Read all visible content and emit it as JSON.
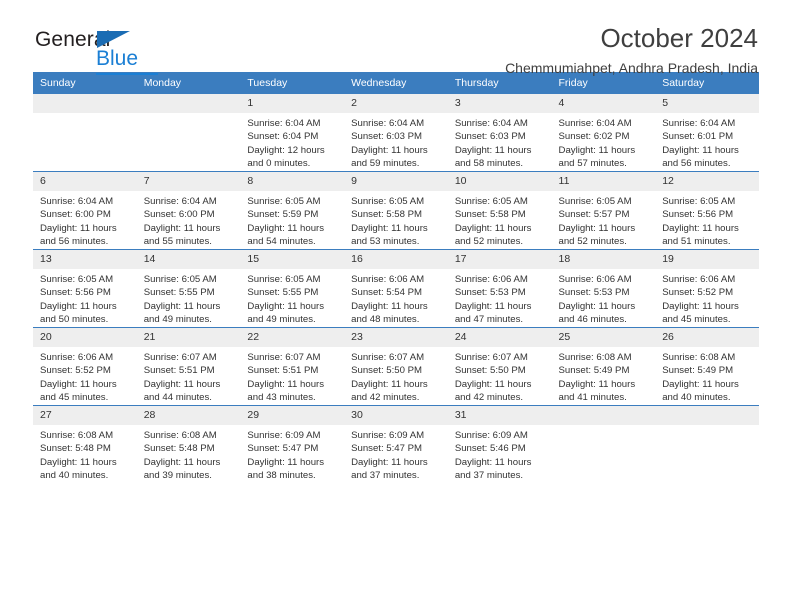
{
  "brand": {
    "name_part1": "General",
    "name_part2": "Blue",
    "logo_icon": "triangle-flag-icon",
    "accent_color": "#1b7fd4",
    "header_color": "#3b7dbf"
  },
  "header": {
    "title": "October 2024",
    "subtitle": "Chemmumiahpet, Andhra Pradesh, India"
  },
  "weekday_headers": [
    "Sunday",
    "Monday",
    "Tuesday",
    "Wednesday",
    "Thursday",
    "Friday",
    "Saturday"
  ],
  "weeks": [
    [
      {
        "day": "",
        "lines": []
      },
      {
        "day": "",
        "lines": []
      },
      {
        "day": "1",
        "lines": [
          "Sunrise: 6:04 AM",
          "Sunset: 6:04 PM",
          "Daylight: 12 hours",
          "and 0 minutes."
        ]
      },
      {
        "day": "2",
        "lines": [
          "Sunrise: 6:04 AM",
          "Sunset: 6:03 PM",
          "Daylight: 11 hours",
          "and 59 minutes."
        ]
      },
      {
        "day": "3",
        "lines": [
          "Sunrise: 6:04 AM",
          "Sunset: 6:03 PM",
          "Daylight: 11 hours",
          "and 58 minutes."
        ]
      },
      {
        "day": "4",
        "lines": [
          "Sunrise: 6:04 AM",
          "Sunset: 6:02 PM",
          "Daylight: 11 hours",
          "and 57 minutes."
        ]
      },
      {
        "day": "5",
        "lines": [
          "Sunrise: 6:04 AM",
          "Sunset: 6:01 PM",
          "Daylight: 11 hours",
          "and 56 minutes."
        ]
      }
    ],
    [
      {
        "day": "6",
        "lines": [
          "Sunrise: 6:04 AM",
          "Sunset: 6:00 PM",
          "Daylight: 11 hours",
          "and 56 minutes."
        ]
      },
      {
        "day": "7",
        "lines": [
          "Sunrise: 6:04 AM",
          "Sunset: 6:00 PM",
          "Daylight: 11 hours",
          "and 55 minutes."
        ]
      },
      {
        "day": "8",
        "lines": [
          "Sunrise: 6:05 AM",
          "Sunset: 5:59 PM",
          "Daylight: 11 hours",
          "and 54 minutes."
        ]
      },
      {
        "day": "9",
        "lines": [
          "Sunrise: 6:05 AM",
          "Sunset: 5:58 PM",
          "Daylight: 11 hours",
          "and 53 minutes."
        ]
      },
      {
        "day": "10",
        "lines": [
          "Sunrise: 6:05 AM",
          "Sunset: 5:58 PM",
          "Daylight: 11 hours",
          "and 52 minutes."
        ]
      },
      {
        "day": "11",
        "lines": [
          "Sunrise: 6:05 AM",
          "Sunset: 5:57 PM",
          "Daylight: 11 hours",
          "and 52 minutes."
        ]
      },
      {
        "day": "12",
        "lines": [
          "Sunrise: 6:05 AM",
          "Sunset: 5:56 PM",
          "Daylight: 11 hours",
          "and 51 minutes."
        ]
      }
    ],
    [
      {
        "day": "13",
        "lines": [
          "Sunrise: 6:05 AM",
          "Sunset: 5:56 PM",
          "Daylight: 11 hours",
          "and 50 minutes."
        ]
      },
      {
        "day": "14",
        "lines": [
          "Sunrise: 6:05 AM",
          "Sunset: 5:55 PM",
          "Daylight: 11 hours",
          "and 49 minutes."
        ]
      },
      {
        "day": "15",
        "lines": [
          "Sunrise: 6:05 AM",
          "Sunset: 5:55 PM",
          "Daylight: 11 hours",
          "and 49 minutes."
        ]
      },
      {
        "day": "16",
        "lines": [
          "Sunrise: 6:06 AM",
          "Sunset: 5:54 PM",
          "Daylight: 11 hours",
          "and 48 minutes."
        ]
      },
      {
        "day": "17",
        "lines": [
          "Sunrise: 6:06 AM",
          "Sunset: 5:53 PM",
          "Daylight: 11 hours",
          "and 47 minutes."
        ]
      },
      {
        "day": "18",
        "lines": [
          "Sunrise: 6:06 AM",
          "Sunset: 5:53 PM",
          "Daylight: 11 hours",
          "and 46 minutes."
        ]
      },
      {
        "day": "19",
        "lines": [
          "Sunrise: 6:06 AM",
          "Sunset: 5:52 PM",
          "Daylight: 11 hours",
          "and 45 minutes."
        ]
      }
    ],
    [
      {
        "day": "20",
        "lines": [
          "Sunrise: 6:06 AM",
          "Sunset: 5:52 PM",
          "Daylight: 11 hours",
          "and 45 minutes."
        ]
      },
      {
        "day": "21",
        "lines": [
          "Sunrise: 6:07 AM",
          "Sunset: 5:51 PM",
          "Daylight: 11 hours",
          "and 44 minutes."
        ]
      },
      {
        "day": "22",
        "lines": [
          "Sunrise: 6:07 AM",
          "Sunset: 5:51 PM",
          "Daylight: 11 hours",
          "and 43 minutes."
        ]
      },
      {
        "day": "23",
        "lines": [
          "Sunrise: 6:07 AM",
          "Sunset: 5:50 PM",
          "Daylight: 11 hours",
          "and 42 minutes."
        ]
      },
      {
        "day": "24",
        "lines": [
          "Sunrise: 6:07 AM",
          "Sunset: 5:50 PM",
          "Daylight: 11 hours",
          "and 42 minutes."
        ]
      },
      {
        "day": "25",
        "lines": [
          "Sunrise: 6:08 AM",
          "Sunset: 5:49 PM",
          "Daylight: 11 hours",
          "and 41 minutes."
        ]
      },
      {
        "day": "26",
        "lines": [
          "Sunrise: 6:08 AM",
          "Sunset: 5:49 PM",
          "Daylight: 11 hours",
          "and 40 minutes."
        ]
      }
    ],
    [
      {
        "day": "27",
        "lines": [
          "Sunrise: 6:08 AM",
          "Sunset: 5:48 PM",
          "Daylight: 11 hours",
          "and 40 minutes."
        ]
      },
      {
        "day": "28",
        "lines": [
          "Sunrise: 6:08 AM",
          "Sunset: 5:48 PM",
          "Daylight: 11 hours",
          "and 39 minutes."
        ]
      },
      {
        "day": "29",
        "lines": [
          "Sunrise: 6:09 AM",
          "Sunset: 5:47 PM",
          "Daylight: 11 hours",
          "and 38 minutes."
        ]
      },
      {
        "day": "30",
        "lines": [
          "Sunrise: 6:09 AM",
          "Sunset: 5:47 PM",
          "Daylight: 11 hours",
          "and 37 minutes."
        ]
      },
      {
        "day": "31",
        "lines": [
          "Sunrise: 6:09 AM",
          "Sunset: 5:46 PM",
          "Daylight: 11 hours",
          "and 37 minutes."
        ]
      },
      {
        "day": "",
        "lines": []
      },
      {
        "day": "",
        "lines": []
      }
    ]
  ]
}
